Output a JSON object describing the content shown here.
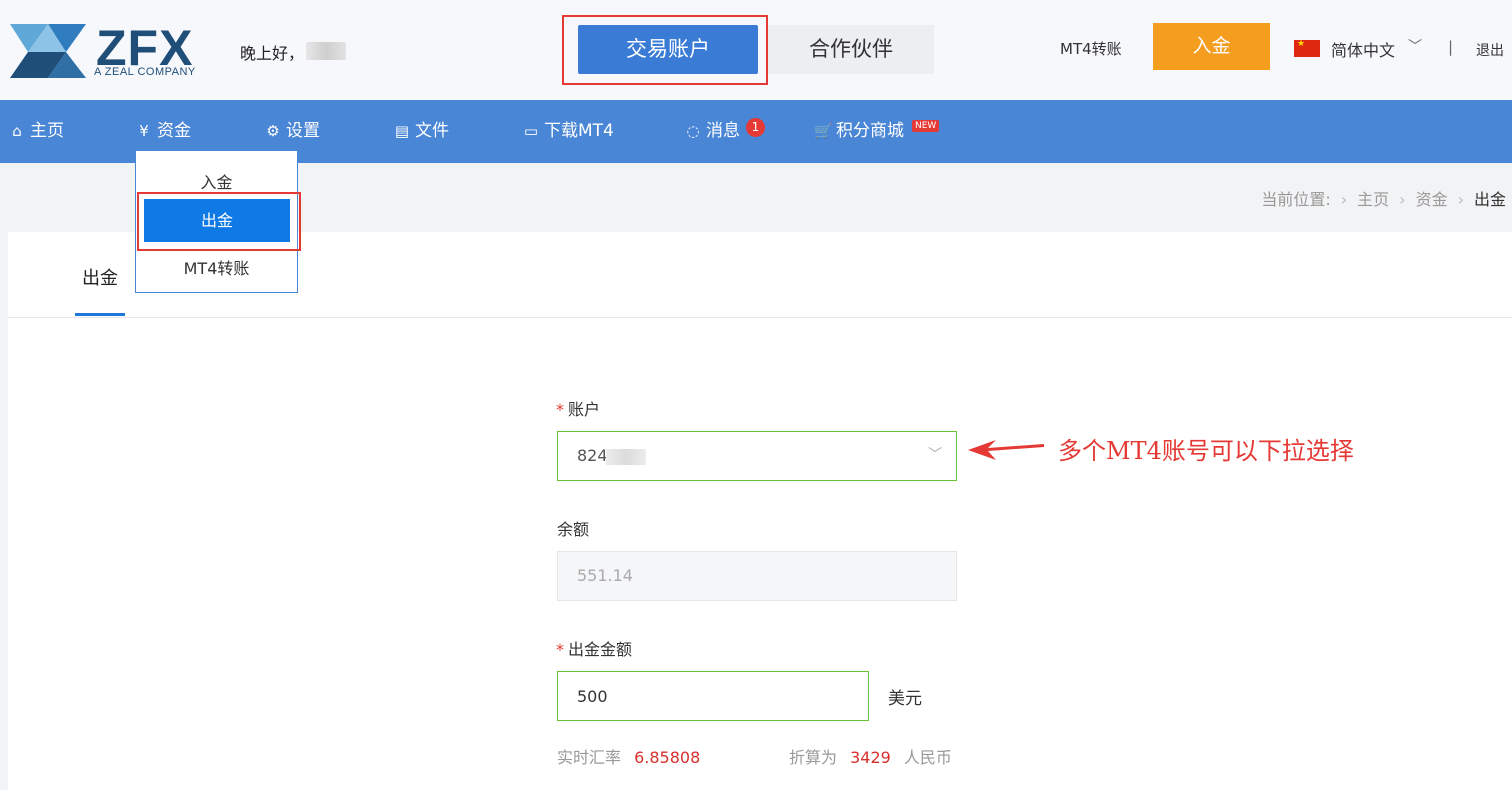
{
  "header": {
    "logo_text": "ZFX",
    "logo_sub": "A ZEAL COMPANY",
    "greeting": "晚上好，",
    "tab_trading": "交易账户",
    "tab_partner": "合作伙伴",
    "mt4_transfer": "MT4转账",
    "deposit_button": "入金",
    "language": "简体中文",
    "separator": "|",
    "logout": "退出"
  },
  "nav": {
    "items": [
      {
        "label": "主页",
        "icon": "home-icon"
      },
      {
        "label": "资金",
        "icon": "yen-icon"
      },
      {
        "label": "设置",
        "icon": "gear-icon"
      },
      {
        "label": "文件",
        "icon": "document-icon"
      },
      {
        "label": "下载MT4",
        "icon": "monitor-icon"
      },
      {
        "label": "消息",
        "icon": "chat-icon"
      },
      {
        "label": "积分商城",
        "icon": "cart-icon"
      }
    ],
    "message_count": "1",
    "new_badge": "NEW"
  },
  "dropdown": {
    "items": [
      "入金",
      "出金",
      "MT4转账"
    ]
  },
  "breadcrumb": {
    "label": "当前位置:",
    "items": [
      "主页",
      "资金",
      "出金"
    ]
  },
  "card": {
    "tab": "出金",
    "account_label": "账户",
    "account_value": "824",
    "balance_label": "余额",
    "balance_value": "551.14",
    "amount_label": "出金金额",
    "amount_value": "500",
    "unit": "美元",
    "rate_label": "实时汇率",
    "rate_value": "6.85808",
    "convert_label": "折算为",
    "convert_value": "3429",
    "convert_unit": "人民币"
  },
  "annotation": {
    "text": "多个MT4账号可以下拉选择",
    "color": "#e53935"
  },
  "colors": {
    "nav_bg": "#4a86d6",
    "primary": "#3a7cd5",
    "deposit": "#f59d1f",
    "valid_border": "#67c23a",
    "highlight": "#e53935"
  }
}
